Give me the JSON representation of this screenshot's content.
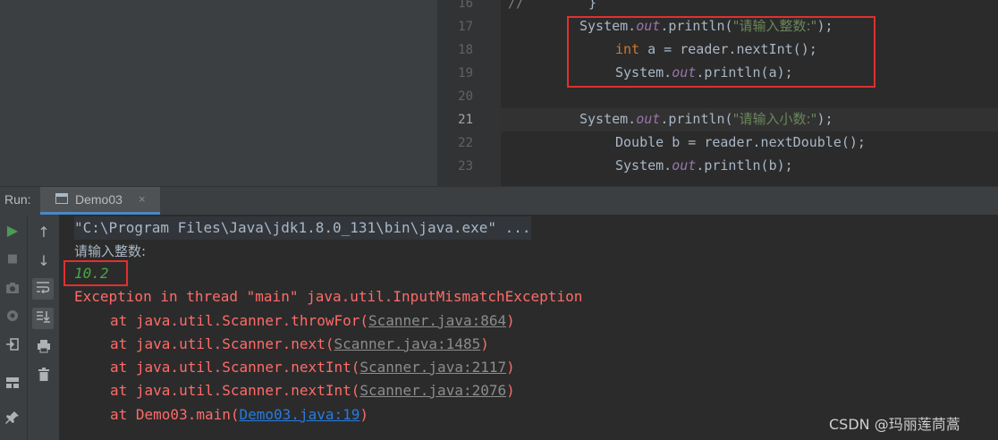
{
  "editor": {
    "lines": [
      {
        "num": "16",
        "active": false
      },
      {
        "num": "17",
        "active": false
      },
      {
        "num": "18",
        "active": false
      },
      {
        "num": "19",
        "active": false
      },
      {
        "num": "20",
        "active": false
      },
      {
        "num": "21",
        "active": true
      },
      {
        "num": "22",
        "active": false
      },
      {
        "num": "23",
        "active": false
      }
    ],
    "line16": {
      "comment": "//",
      "brace": "}"
    },
    "line17": {
      "a": "System.",
      "b": "out",
      "c": ".println(",
      "d": "\"请输入整数:\"",
      "e": ");"
    },
    "line18": {
      "a": "int",
      "b": " a = reader.nextInt();"
    },
    "line19": {
      "a": "System.",
      "b": "out",
      "c": ".println(a);"
    },
    "line21": {
      "a": "System.",
      "b": "out",
      "c": ".println(",
      "d": "\"请输入小数:\"",
      "e": ");"
    },
    "line22": {
      "a": "Double b = reader.nextDouble();"
    },
    "line23": {
      "a": "System.",
      "b": "out",
      "c": ".println(b);"
    }
  },
  "run": {
    "label": "Run:",
    "tab_label": "Demo03",
    "close": "×"
  },
  "console": {
    "command": "\"C:\\Program Files\\Java\\jdk1.8.0_131\\bin\\java.exe\" ...",
    "prompt": "请输入整数:",
    "input": "10.2",
    "exception": "Exception in thread \"main\" java.util.InputMismatchException",
    "stack": [
      {
        "prefix": "at java.util.Scanner.throwFor(",
        "link": "Scanner.java:864",
        "suffix": ")"
      },
      {
        "prefix": "at java.util.Scanner.next(",
        "link": "Scanner.java:1485",
        "suffix": ")"
      },
      {
        "prefix": "at java.util.Scanner.nextInt(",
        "link": "Scanner.java:2117",
        "suffix": ")"
      },
      {
        "prefix": "at java.util.Scanner.nextInt(",
        "link": "Scanner.java:2076",
        "suffix": ")"
      },
      {
        "prefix": "at Demo03.main(",
        "link": "Demo03.java:19",
        "suffix": ")"
      }
    ]
  },
  "toolbar": {
    "run": "▶",
    "stop": "■",
    "up": "↑",
    "down": "↓",
    "icons": [
      "run-icon",
      "stop-icon",
      "camera-icon",
      "settings-icon",
      "exit-icon",
      "layout-icon",
      "pin-icon",
      "up-arrow-icon",
      "down-arrow-icon",
      "soft-wrap-icon",
      "scroll-to-end-icon",
      "print-icon",
      "trash-icon"
    ]
  },
  "watermark": "CSDN @玛丽莲茼蒿",
  "colors": {
    "highlight_box": "#e0302f",
    "error": "#ff6b68",
    "input": "#4aa744",
    "link_blue": "#287bde"
  }
}
